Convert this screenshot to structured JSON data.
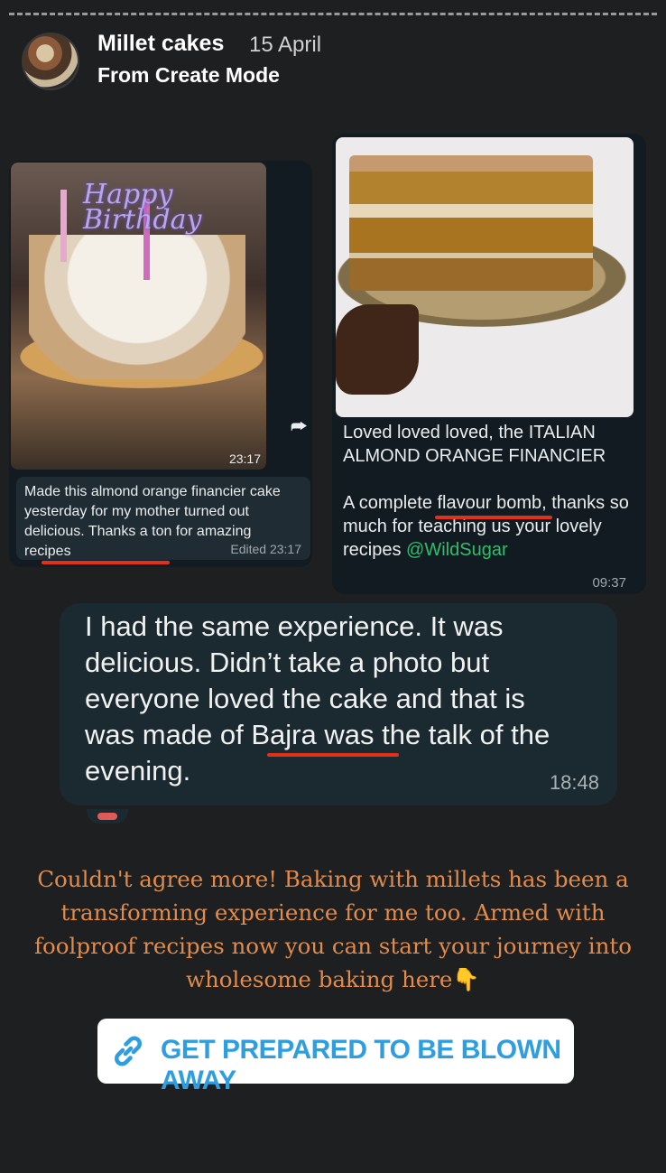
{
  "story": {
    "title": "Millet cakes",
    "date": "15 April",
    "subtitle": "From Create Mode"
  },
  "left_chat": {
    "photo_time": "23:17",
    "caption": "Made this almond orange financier cake yesterday for my mother turned out delicious. Thanks  a ton for amazing recipes",
    "edited": "Edited 23:17",
    "topper_text": "Happy Birthday"
  },
  "right_chat": {
    "caption_line1": "Loved loved loved,  the ITALIAN ALMOND ORANGE FINANCIER",
    "caption_line2": "A complete flavour bomb, thanks so much for teaching us your lovely recipes",
    "mention": "@WildSugar",
    "time": "09:37"
  },
  "reply_bubble": {
    "text": "I had the same experience. It was delicious. Didn’t take a photo but everyone loved the cake and that is was made of Bajra was the talk of the evening.",
    "time": "18:48"
  },
  "message": "Couldn't agree more! Baking with millets has been a transforming experience for me too. Armed with foolproof recipes now you can start your journey into wholesome baking here👇",
  "link_button": {
    "label": "GET PREPARED TO BE BLOWN AWAY",
    "icon": "link-icon",
    "color": "#2f9ee0"
  },
  "colors": {
    "background": "#1e1f21",
    "underline": "#e2311b",
    "message": "#e28b4a",
    "mention": "#2fbe6b"
  }
}
